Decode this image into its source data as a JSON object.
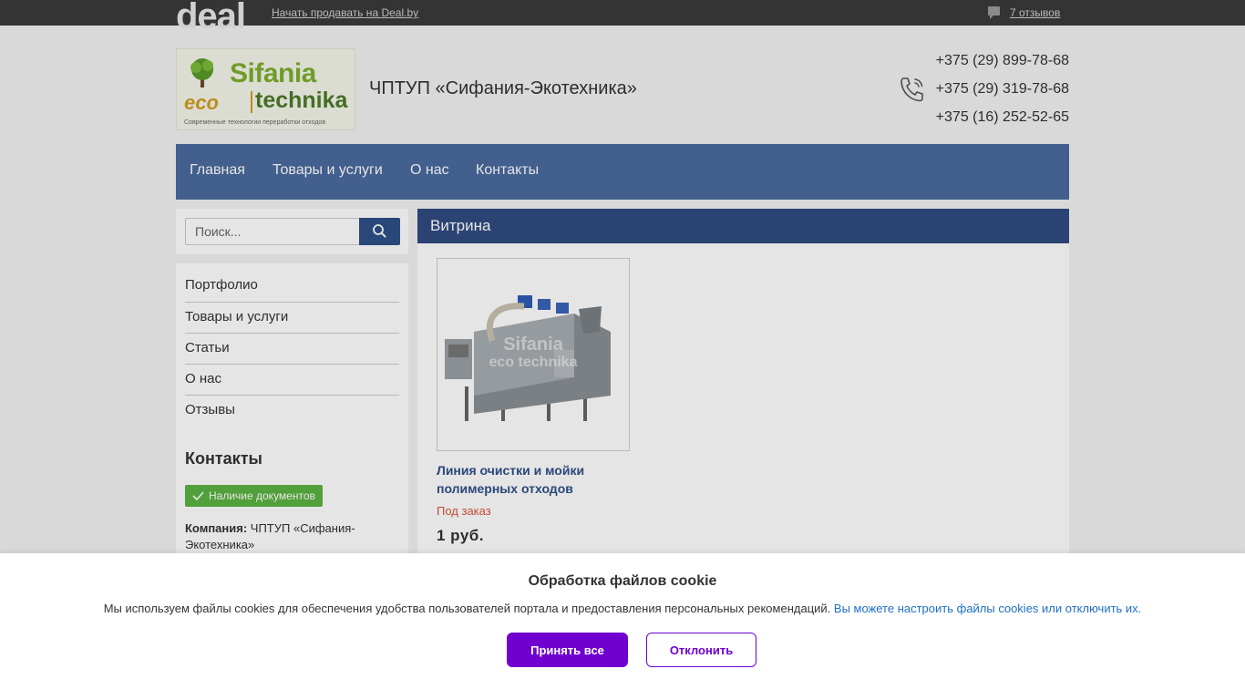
{
  "topbar": {
    "logo": "deal",
    "sell_link": "Начать продавать на Deal.by",
    "reviews_icon": "speech-bubble-icon",
    "reviews_link": "7 отзывов"
  },
  "header": {
    "logo": {
      "name": "Sifania",
      "eco": "eco",
      "technika": "technika",
      "tagline": "Современные технологии переработки отходов"
    },
    "company_name": "ЧПТУП «Сифания-Экотехника»",
    "phone_icon": "phone-icon",
    "phones": [
      "+375 (29) 899-78-68",
      "+375 (29) 319-78-68",
      "+375 (16) 252-52-65"
    ]
  },
  "nav": {
    "items": [
      "Главная",
      "Товары и услуги",
      "О нас",
      "Контакты"
    ]
  },
  "sidebar": {
    "search_placeholder": "Поиск...",
    "search_icon": "search-icon",
    "menu": [
      "Портфолио",
      "Товары и услуги",
      "Статьи",
      "О нас",
      "Отзывы"
    ],
    "contacts_title": "Контакты",
    "docs_badge": "Наличие документов",
    "company_label": "Компания:",
    "company_value": "ЧПТУП «Сифания-Экотехника»"
  },
  "main": {
    "title": "Витрина",
    "product": {
      "image_watermark": [
        "Sifania",
        "eco technika"
      ],
      "title": "Линия очистки и мойки полимерных отходов",
      "status": "Под заказ",
      "price": "1 руб."
    }
  },
  "cookie": {
    "title": "Обработка файлов cookie",
    "text": "Мы используем файлы cookies для обеспечения удобства пользователей портала и предоставления персональных рекомендаций.",
    "link": "Вы можете настроить файлы cookies или отключить их.",
    "accept": "Принять все",
    "decline": "Отклонить"
  },
  "colors": {
    "topbar": "#3a3a3a",
    "nav": "#4a6a9e",
    "main_header": "#2f4b80",
    "accent_purple": "#7000d0",
    "status_red": "#d8553f",
    "badge_green": "#5cb342",
    "link_blue": "#1e6fc5"
  }
}
